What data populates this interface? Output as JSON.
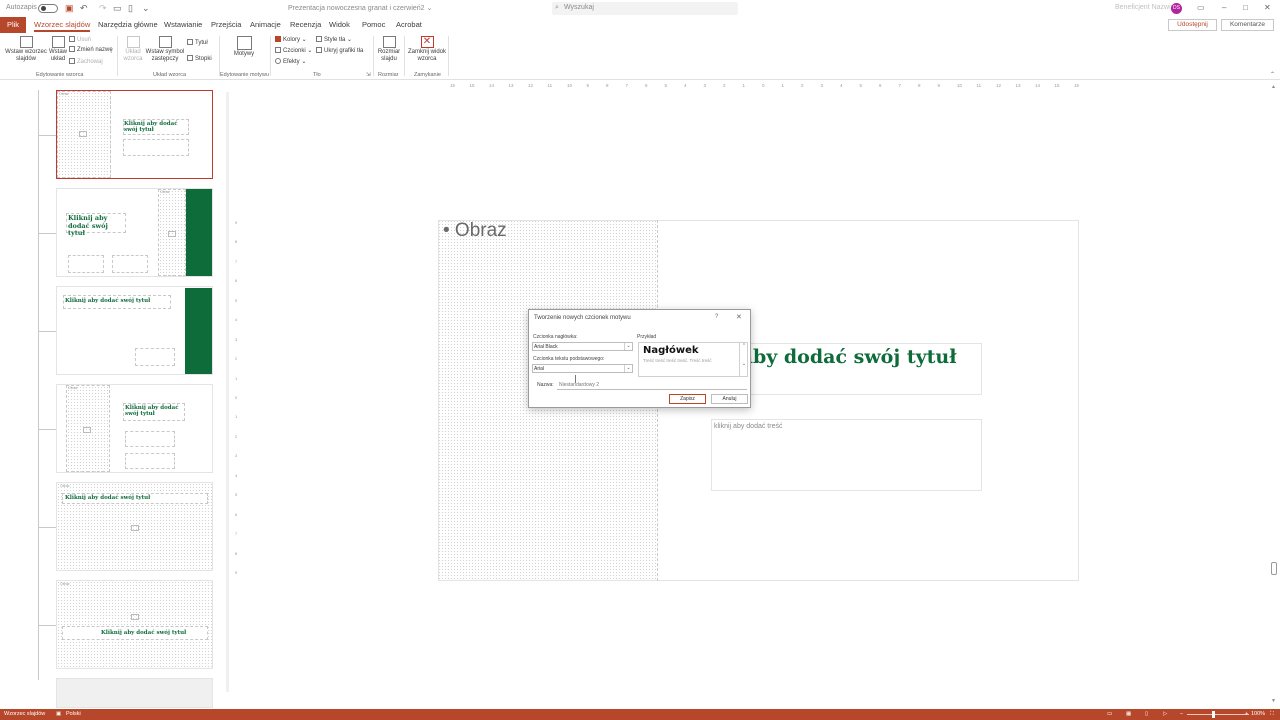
{
  "titlebar": {
    "autosave_label": "Autozapis",
    "doc_title": "Prezentacja nowoczesna granat i czerwień2 ⌄",
    "search_placeholder": "Wyszukaj",
    "account_name": "Beneficjent Nazwisko",
    "avatar_initials": "DS"
  },
  "tabs": [
    {
      "label": "Plik"
    },
    {
      "label": "Wzorzec slajdów"
    },
    {
      "label": "Narzędzia główne"
    },
    {
      "label": "Wstawianie"
    },
    {
      "label": "Przejścia"
    },
    {
      "label": "Animacje"
    },
    {
      "label": "Recenzja"
    },
    {
      "label": "Widok"
    },
    {
      "label": "Pomoc"
    },
    {
      "label": "Acrobat"
    }
  ],
  "share_label": "Udostępnij",
  "comments_label": "Komentarze",
  "ribbon": {
    "insert_master": "Wstaw wzorzec slajdów",
    "insert_layout": "Wstaw układ",
    "delete": "Usuń",
    "rename": "Zmień nazwę",
    "preserve": "Zachowaj",
    "group_edit_master": "Edytowanie wzorca",
    "master_layout": "Układ wzorca",
    "insert_placeholder": "Wstaw symbol zastępczy",
    "title_check": "Tytuł",
    "footers_check": "Stopki",
    "group_master_layout": "Układ wzorca",
    "themes": "Motywy",
    "group_edit_theme": "Edytowanie motywu",
    "colors": "Kolory",
    "fonts": "Czcionki",
    "effects": "Efekty",
    "bg_styles": "Style tła",
    "hide_bg": "Ukryj grafiki tła",
    "group_background": "Tło",
    "slide_size": "Rozmiar slajdu",
    "group_size": "Rozmiar",
    "close_master": "Zamknij widok wzorca",
    "group_close": "Zamykanie"
  },
  "thumbnails": [
    {
      "title": "Kliknij aby dodać swój tytuł",
      "label": "Obraz"
    },
    {
      "title": "Kliknij aby dodać swój tytuł",
      "label": "Obraz"
    },
    {
      "title": "Kliknij aby dodać swój tytuł"
    },
    {
      "title": "Kliknij aby dodać swój tytuł",
      "label": "Obraz"
    },
    {
      "title": "Kliknij aby dodać swój tytuł",
      "label": "Obraz"
    },
    {
      "title": "Kliknij aby dodać swój tytuł",
      "label": "Obraz"
    }
  ],
  "slide": {
    "picture_label": "• Obraz",
    "title_text": "Kliknij aby dodać swój tytuł",
    "body_text": "kliknij aby dodać treść"
  },
  "ruler_h": [
    "16",
    "15",
    "14",
    "13",
    "12",
    "11",
    "10",
    "9",
    "8",
    "7",
    "6",
    "5",
    "4",
    "3",
    "2",
    "1",
    "0",
    "1",
    "2",
    "3",
    "4",
    "5",
    "6",
    "7",
    "8",
    "9",
    "10",
    "11",
    "12",
    "13",
    "14",
    "15",
    "16"
  ],
  "ruler_v": [
    "9",
    "8",
    "7",
    "6",
    "5",
    "4",
    "3",
    "2",
    "1",
    "0",
    "1",
    "2",
    "3",
    "4",
    "5",
    "6",
    "7",
    "8",
    "9"
  ],
  "dialog": {
    "title": "Tworzenie nowych czcionek motywu",
    "help": "?",
    "close": "✕",
    "heading_font_label": "Czcionka nagłówka:",
    "heading_font_value": "Arial Black",
    "body_font_label": "Czcionka tekstu podstawowego:",
    "body_font_value": "Arial",
    "preview_label": "Przykład",
    "preview_heading": "Nagłówek",
    "preview_body": "Treść treść treść treść. Treść treść",
    "name_label": "Nazwa:",
    "name_value": "Niestandardowy 2",
    "save": "Zapisz",
    "cancel": "Anuluj"
  },
  "status": {
    "view_name": "Wzorzec slajdów",
    "language": "Polski",
    "zoom": "100%"
  },
  "colors": {
    "accent": "#b7472a",
    "title_green": "#0e6b3a"
  }
}
